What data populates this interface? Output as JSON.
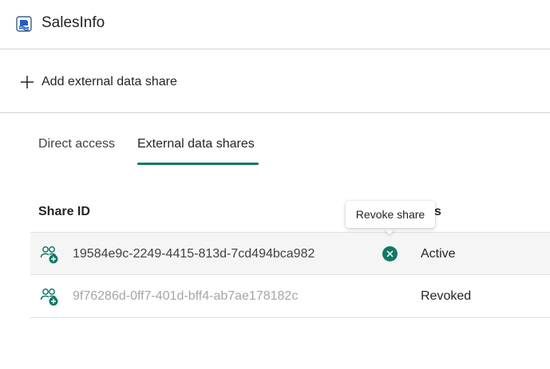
{
  "header": {
    "title": "SalesInfo",
    "icon": "semantic-model-icon"
  },
  "toolbar": {
    "add_label": "Add external data share"
  },
  "tabs": [
    {
      "label": "Direct access",
      "selected": false
    },
    {
      "label": "External data shares",
      "selected": true
    }
  ],
  "table": {
    "columns": {
      "share_id": "Share ID",
      "status": "atus"
    },
    "rows": [
      {
        "share_id": "19584e9c-2249-4415-813d-7cd494bca982",
        "status": "Active"
      },
      {
        "share_id": "9f76286d-0ff7-401d-bff4-ab7ae178182c",
        "status": "Revoked"
      }
    ]
  },
  "tooltip": {
    "text": "Revoke share"
  },
  "colors": {
    "accent": "#117865",
    "disabled_text": "#a6a6a6"
  }
}
